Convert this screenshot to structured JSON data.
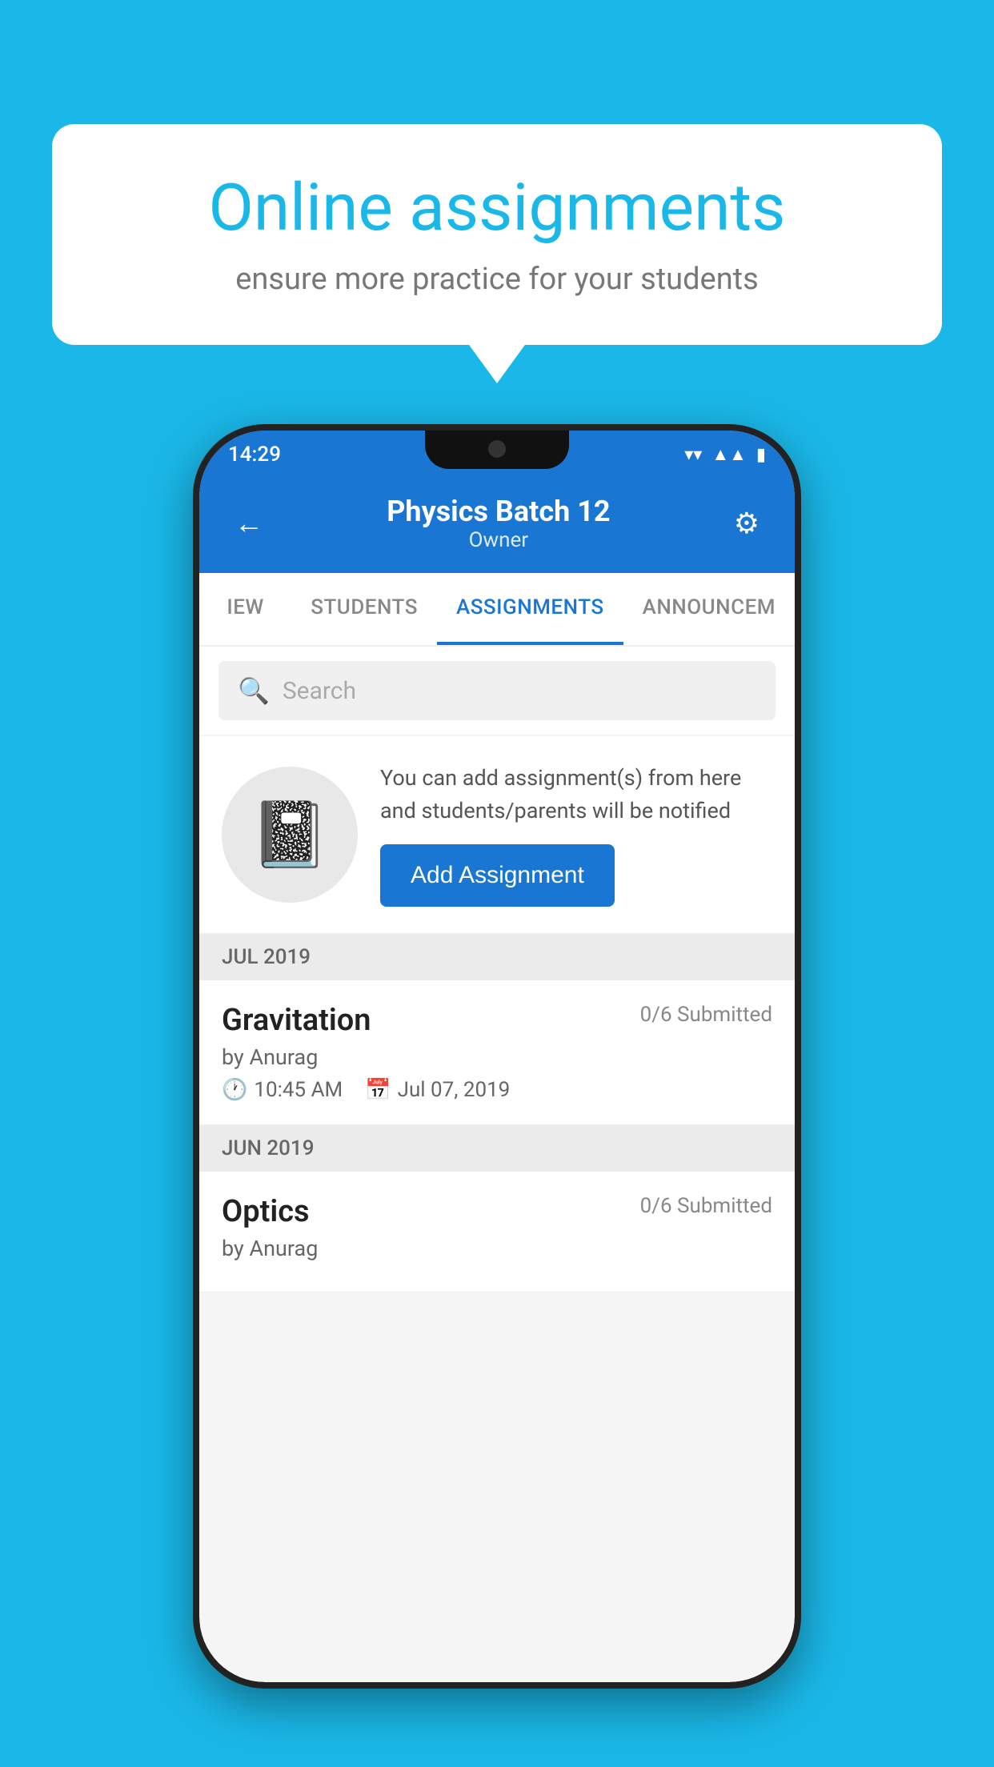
{
  "background_color": "#1ab8e8",
  "speech_bubble": {
    "title": "Online assignments",
    "subtitle": "ensure more practice for your students"
  },
  "phone": {
    "status_bar": {
      "time": "14:29"
    },
    "header": {
      "title": "Physics Batch 12",
      "subtitle": "Owner",
      "back_label": "←",
      "settings_label": "⚙"
    },
    "tabs": [
      {
        "label": "IEW",
        "active": false
      },
      {
        "label": "STUDENTS",
        "active": false
      },
      {
        "label": "ASSIGNMENTS",
        "active": true
      },
      {
        "label": "ANNOUNCEM",
        "active": false
      }
    ],
    "search": {
      "placeholder": "Search"
    },
    "info_card": {
      "text": "You can add assignment(s) from here and students/parents will be notified",
      "button_label": "Add Assignment"
    },
    "months": [
      {
        "label": "JUL 2019",
        "assignments": [
          {
            "title": "Gravitation",
            "submitted": "0/6 Submitted",
            "author": "by Anurag",
            "time": "10:45 AM",
            "date": "Jul 07, 2019"
          }
        ]
      },
      {
        "label": "JUN 2019",
        "assignments": [
          {
            "title": "Optics",
            "submitted": "0/6 Submitted",
            "author": "by Anurag",
            "time": "",
            "date": ""
          }
        ]
      }
    ]
  }
}
